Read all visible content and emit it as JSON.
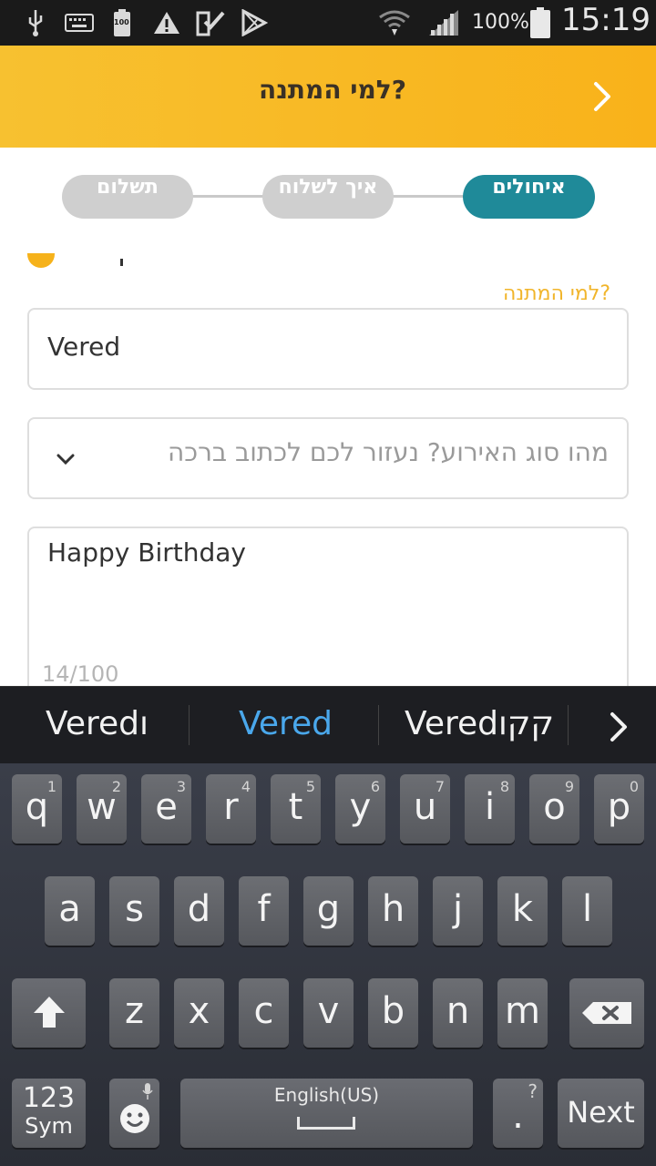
{
  "status_bar": {
    "battery_percent": "100%",
    "time": "15:19",
    "battery_small": "100"
  },
  "header": {
    "title": "למי המתנה?"
  },
  "stepper": {
    "steps": [
      {
        "label": "איחולים",
        "state": "active"
      },
      {
        "label": "איך לשלוח",
        "state": "inactive"
      },
      {
        "label": "תשלום",
        "state": "inactive"
      }
    ]
  },
  "form": {
    "recipient_label": "למי המתנה?",
    "recipient_value": "Vered",
    "event_type_placeholder": "מהו סוג האירוע? נעזור לכם לכתוב ברכה",
    "message_value": "Happy Birthday",
    "message_counter": "14/100"
  },
  "suggestions": [
    "Veredı",
    "Vered",
    "Veredקקו"
  ],
  "keyboard": {
    "row1": [
      {
        "k": "q",
        "n": "1"
      },
      {
        "k": "w",
        "n": "2"
      },
      {
        "k": "e",
        "n": "3"
      },
      {
        "k": "r",
        "n": "4"
      },
      {
        "k": "t",
        "n": "5"
      },
      {
        "k": "y",
        "n": "6"
      },
      {
        "k": "u",
        "n": "7"
      },
      {
        "k": "i",
        "n": "8"
      },
      {
        "k": "o",
        "n": "9"
      },
      {
        "k": "p",
        "n": "0"
      }
    ],
    "row2": [
      "a",
      "s",
      "d",
      "f",
      "g",
      "h",
      "j",
      "k",
      "l"
    ],
    "row3": [
      "z",
      "x",
      "c",
      "v",
      "b",
      "n",
      "m"
    ],
    "sym_top": "123",
    "sym_bottom": "Sym",
    "space_label": "English(US)",
    "period": ".",
    "period_hint": "?",
    "next_label": "Next"
  },
  "colors": {
    "header_bg": "#f9b21a",
    "step_active": "#1f8a99",
    "step_inactive": "#cfcfcf",
    "label_accent": "#f1b52b",
    "suggestion_highlight": "#4aa8ec"
  }
}
